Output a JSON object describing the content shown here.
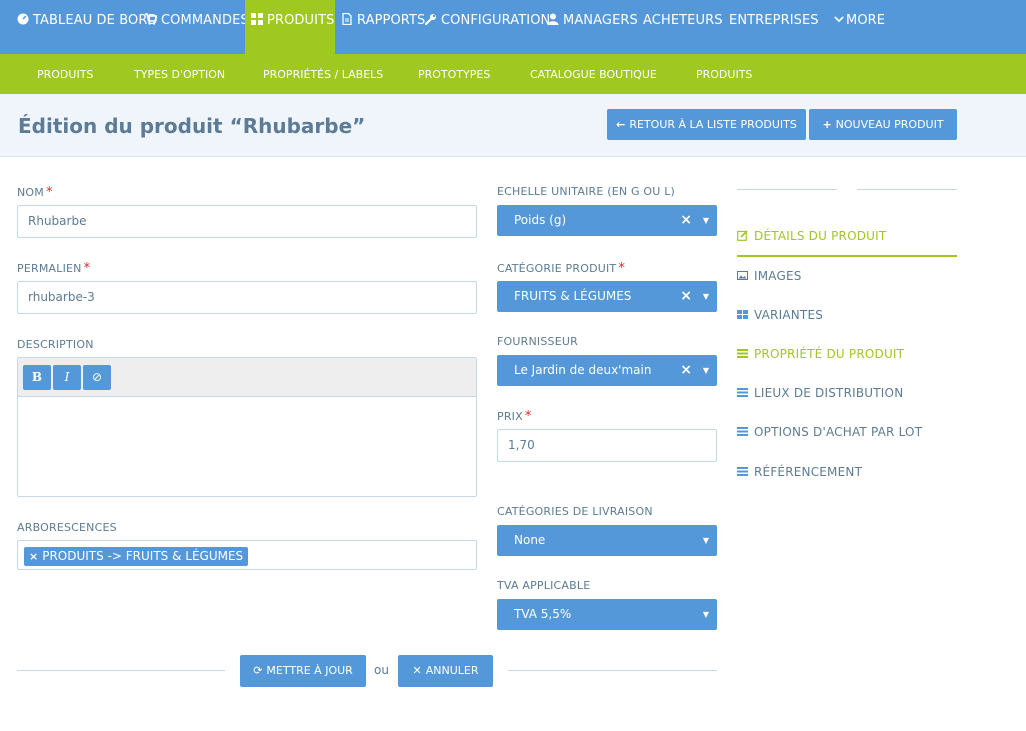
{
  "topnav": {
    "items": [
      {
        "label": "TABLEAU DE BORD",
        "icon": "dashboard-icon"
      },
      {
        "label": "COMMANDES",
        "icon": "cart-icon"
      },
      {
        "label": "PRODUITS",
        "icon": "grid-icon",
        "active": true
      },
      {
        "label": "RAPPORTS",
        "icon": "file-icon"
      },
      {
        "label": "CONFIGURATION",
        "icon": "wrench-icon"
      },
      {
        "label": "MANAGERS",
        "icon": "user-icon"
      },
      {
        "label": "ACHETEURS"
      },
      {
        "label": "ENTREPRISES"
      },
      {
        "label": "MORE",
        "icon": "chevron-down-icon"
      }
    ]
  },
  "subnav": {
    "items": [
      "PRODUITS",
      "TYPES D'OPTION",
      "PROPRIÉTÉS / LABELS",
      "PROTOTYPES",
      "CATALOGUE BOUTIQUE",
      "PRODUITS"
    ]
  },
  "header": {
    "title": "Édition du produit “Rhubarbe”",
    "back_button": "RETOUR À LA LISTE PRODUITS",
    "new_button": "NOUVEAU PRODUIT"
  },
  "form": {
    "name": {
      "label": "NOM",
      "value": "Rhubarbe"
    },
    "permalink": {
      "label": "PERMALIEN",
      "value": "rhubarbe-3"
    },
    "description": {
      "label": "DESCRIPTION",
      "bold": "B",
      "italic": "I",
      "clear": "⊘"
    },
    "taxons": {
      "label": "ARBORESCENCES",
      "tags": [
        "PRODUITS -> FRUITS & LÉGUMES"
      ]
    },
    "unit_scale": {
      "label": "ECHELLE UNITAIRE (EN G OU L)",
      "value": "Poids (g)"
    },
    "category": {
      "label": "CATÉGORIE PRODUIT",
      "value": "FRUITS & LÉGUMES"
    },
    "supplier": {
      "label": "FOURNISSEUR",
      "value": "Le Jardin de deux'main"
    },
    "price": {
      "label": "PRIX",
      "value": "1,70"
    },
    "shipping": {
      "label": "CATÉGORIES DE LIVRAISON",
      "value": "None"
    },
    "tax": {
      "label": "TVA APPLICABLE",
      "value": "TVA 5,5%"
    },
    "update_button": "METTRE À JOUR",
    "or_text": "ou",
    "cancel_button": "ANNULER"
  },
  "sidebar": {
    "items": [
      {
        "label": "DÉTAILS DU PRODUIT",
        "icon": "edit-icon",
        "active": true
      },
      {
        "label": "IMAGES",
        "icon": "image-icon"
      },
      {
        "label": "VARIANTES",
        "icon": "grid-icon"
      },
      {
        "label": "PROPRIÉTÉ DU PRODUIT",
        "icon": "list-icon",
        "highlight": true
      },
      {
        "label": "LIEUX DE DISTRIBUTION",
        "icon": "list-icon"
      },
      {
        "label": "OPTIONS D'ACHAT PAR LOT",
        "icon": "list-icon"
      },
      {
        "label": "RÉFÉRENCEMENT",
        "icon": "list-icon"
      }
    ]
  },
  "colors": {
    "primary": "#5498da",
    "accent": "#9fc820",
    "text": "#5c7b96",
    "required": "#e0262b"
  }
}
